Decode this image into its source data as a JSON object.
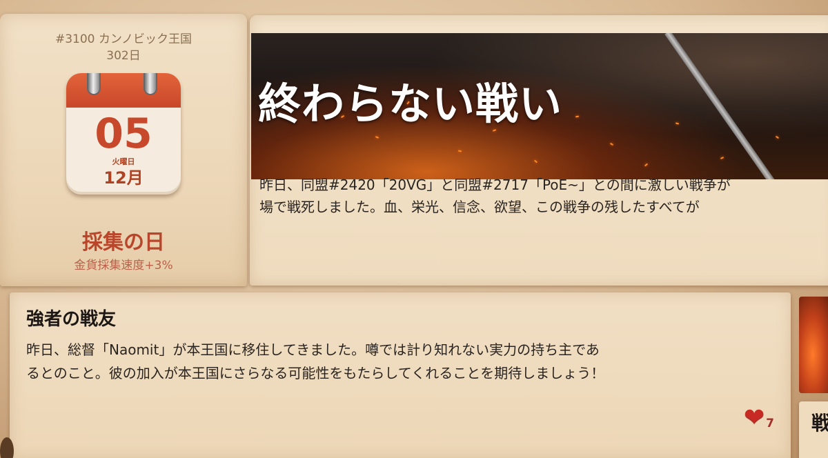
{
  "calendar_panel": {
    "kingdom": "#3100 カンノビック王国",
    "days": "302日",
    "day": "05",
    "weekday": "火曜日",
    "month": "12月",
    "event_title": "採集の日",
    "event_effect": "金貨採集速度+3%"
  },
  "news": {
    "title": "終わらない戦い",
    "lines": [
      "昨日、同盟#2420「20VG」と同盟#2717「PoE~」との間に激しい戦争が",
      "場で戦死しました。血、栄光、信念、欲望、この戦争の残したすべてが"
    ]
  },
  "ally_news": {
    "title": "強者の戦友",
    "lines": [
      "昨日、総督「Naomit」が本王国に移住してきました。噂では計り知れない実力の持ち主であ",
      "るとのこと。彼の加入が本王国にさらなる可能性をもたらしてくれることを期待しましょう！"
    ],
    "likes": "7"
  },
  "side_card": {
    "label": "戦"
  },
  "colors": {
    "accent_red": "#c7482b",
    "heart": "#c62a22",
    "paper": "#f2e1c7"
  },
  "icons": {
    "like": "heart-icon",
    "calendar": "calendar-icon"
  }
}
